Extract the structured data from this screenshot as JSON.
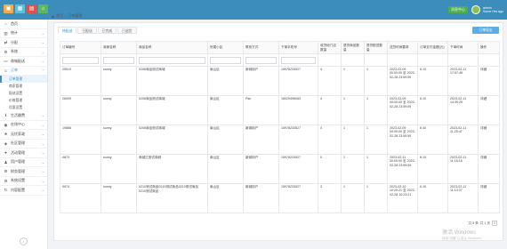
{
  "colors": {
    "primary": "#3c8dbc",
    "top_btn_1": "#f0ad4e",
    "top_btn_2": "#5bc0de",
    "top_btn_3": "#d9534f",
    "top_btn_4": "#5cb85c",
    "msg_badge": "#4cae4c"
  },
  "top": {
    "buttons": [
      {
        "icon": "file-icon",
        "glyph": "▣"
      },
      {
        "icon": "grid-icon",
        "glyph": "▦"
      },
      {
        "icon": "doc-icon",
        "glyph": "▤"
      },
      {
        "icon": "home-icon",
        "glyph": "⌂"
      }
    ],
    "message_label": "消息中心",
    "user_name": "admin",
    "user_role": "Some Hrs ago"
  },
  "sidebar": {
    "items": [
      {
        "label": "首页",
        "icon": "home-icon",
        "glyph": "⌂"
      },
      {
        "label": "统计",
        "icon": "chart-icon",
        "glyph": "▥"
      },
      {
        "label": "分配",
        "icon": "share-icon",
        "glyph": "⇄"
      },
      {
        "label": "系统",
        "icon": "gear-icon",
        "glyph": "⚙"
      },
      {
        "label": "商城配送",
        "icon": "truck-icon",
        "glyph": "▭"
      },
      {
        "label": "订单",
        "icon": "order-icon",
        "glyph": "≡",
        "active": true
      }
    ],
    "sub_items": [
      {
        "label": "订单管理",
        "active": true
      },
      {
        "label": "商家管理"
      },
      {
        "label": "配送设置"
      },
      {
        "label": "价格管理"
      },
      {
        "label": "优惠设置"
      }
    ],
    "items_after": [
      {
        "label": "生活缴费",
        "icon": "info-icon",
        "glyph": "ℹ"
      },
      {
        "label": "在线中心",
        "icon": "globe-icon",
        "glyph": "◉"
      },
      {
        "label": "无忧家政",
        "icon": "star-icon",
        "glyph": "★"
      },
      {
        "label": "社区管理",
        "icon": "shield-icon",
        "glyph": "◈"
      },
      {
        "label": "活动管理",
        "icon": "person-icon",
        "glyph": "●"
      },
      {
        "label": "用户管理",
        "icon": "users-icon",
        "glyph": "♟"
      },
      {
        "label": "财务管理",
        "icon": "gear-icon",
        "glyph": "⚙"
      },
      {
        "label": "系统设置",
        "icon": "settings-icon",
        "glyph": "⚙"
      },
      {
        "label": "内容配置",
        "icon": "refresh-icon",
        "glyph": "↻"
      }
    ]
  },
  "breadcrumb": {
    "home_glyph": "◆",
    "home": "首页",
    "sep": "/",
    "current": "订单管理"
  },
  "tabs": [
    "待配送",
    "已配送",
    "已完成",
    "已退货"
  ],
  "export_label": "订单导出",
  "table": {
    "columns": [
      "订单编号",
      "商家名称",
      "商品名称",
      "所属小区",
      "联系方式",
      "下单手机号",
      "收货地门店数量",
      "退货商品数量",
      "退货配送数量",
      "送货时间要求",
      "订单支付金额(元)",
      "下单时间",
      "操作"
    ],
    "rows": [
      [
        "25919",
        "sunny",
        "0206商品测试商城",
        "南山区",
        "新城用户",
        "15978233527",
        "4",
        "1",
        "1",
        "2023-02-09 00:00:00 至 2023-02-28 23:59:59",
        "6.10",
        "2023-02-11 17:57:48",
        "详细"
      ],
      [
        "26009",
        "sunny",
        "0206商品测试商城",
        "南山区",
        "Pan",
        "18029496083",
        "4",
        "1",
        "1",
        "2023-02-09 00:00:00 至 2023-02-28 23:59:59",
        "6.10",
        "2023-02-11 14:39:29",
        "详细"
      ],
      [
        "19886",
        "sunny",
        "0206商品测试商城",
        "南山区",
        "新城用户",
        "15978233527",
        "4",
        "1",
        "1",
        "2023-02-09 00:00:00 至 2023-02-28 23:59:59",
        "6.40",
        "2023-02-11 11:25:47",
        "详细"
      ],
      [
        "4873",
        "sunny",
        "商城正测试商城",
        "南山区",
        "新城用户",
        "15978233527",
        "0",
        "1",
        "1",
        "2023-02-11 00:00:00 至 2023-02-28 23:59:59",
        "6.10",
        "2023-02-11 11:16:16",
        "详细"
      ],
      [
        "9974",
        "sunny",
        "0210测试商品0210测试商品0210测试商品0210测试商品",
        "南山区",
        "新城用户",
        "15978233527",
        "3",
        "1",
        "1",
        "2023-02-10 10:20:21 至 2023-02-28 10:23:21",
        "6.10",
        "2023-02-11 11:14:37",
        "详细"
      ]
    ]
  },
  "pager": {
    "summary": "共 5 条, 共 1 页",
    "current": "1"
  },
  "watermark": {
    "title": "激活 Windows",
    "subtitle": "转到\"设置\"以激活 Windows。"
  }
}
